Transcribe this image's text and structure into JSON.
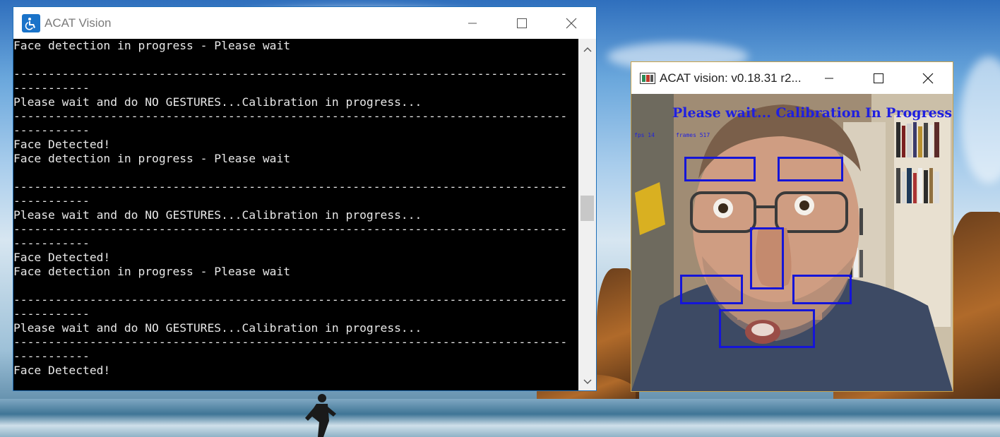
{
  "console": {
    "title": "ACAT Vision",
    "lines": [
      "Face detection in progress - Please wait",
      "",
      "--------------------------------------------------------------------------------",
      "-----------",
      "Please wait and do NO GESTURES...Calibration in progress...",
      "--------------------------------------------------------------------------------",
      "-----------",
      "Face Detected!",
      "Face detection in progress - Please wait",
      "",
      "--------------------------------------------------------------------------------",
      "-----------",
      "Please wait and do NO GESTURES...Calibration in progress...",
      "--------------------------------------------------------------------------------",
      "-----------",
      "Face Detected!",
      "Face detection in progress - Please wait",
      "",
      "--------------------------------------------------------------------------------",
      "-----------",
      "Please wait and do NO GESTURES...Calibration in progress...",
      "--------------------------------------------------------------------------------",
      "-----------",
      "Face Detected!"
    ]
  },
  "vision": {
    "title": "ACAT vision: v0.18.31 r2...",
    "overlay_text": "Please wait... Calibration In Progress (fa",
    "fps_label": "fps 14",
    "frame_label": "frames 517",
    "box_color": "#1515d8"
  },
  "colors": {
    "console_bg": "#000000",
    "console_text": "#e8e8e8",
    "overlay_blue": "#1f1fe0"
  },
  "icons": {
    "console_app": "acat-accessibility-icon",
    "vision_app": "opencv-window-icon",
    "minimize": "minimize-icon",
    "maximize": "maximize-icon",
    "close": "close-icon"
  }
}
